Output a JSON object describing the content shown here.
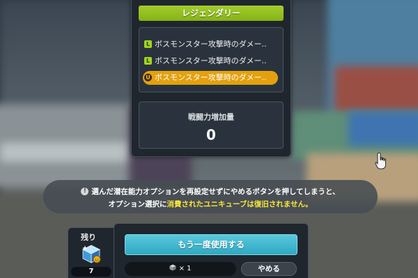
{
  "popup": {
    "grade_label": "レジェンダリー",
    "options": [
      {
        "badge": "L",
        "text": "ボスモンスター攻撃時のダメー..",
        "selected": false
      },
      {
        "badge": "L",
        "text": "ボスモンスター攻撃時のダメー..",
        "selected": false
      },
      {
        "badge": "U",
        "text": "ボスモンスター攻撃時のダメー..",
        "selected": true
      }
    ],
    "power_label": "戦闘力増加量",
    "power_value": "0"
  },
  "warning": {
    "icon": "exclamation-icon",
    "line1": "選んだ潜在能力オプションを再設定せずにやめるボタンを押してしまうと、",
    "line2_prefix": "オプション選択に",
    "line2_highlight": "消費されたユニキューブは復旧されません。"
  },
  "remaining": {
    "label": "残り",
    "count": "7",
    "icon": "unicube-icon"
  },
  "actions": {
    "use_again_label": "もう一度使用する",
    "cost_text": "× 1",
    "cost_icon": "cube-icon",
    "quit_label": "やめる"
  },
  "colors": {
    "legendary": "#9fd61e",
    "unique": "#e3a10f",
    "accent": "#3fb8d0",
    "highlight_text": "#f8e43a"
  }
}
